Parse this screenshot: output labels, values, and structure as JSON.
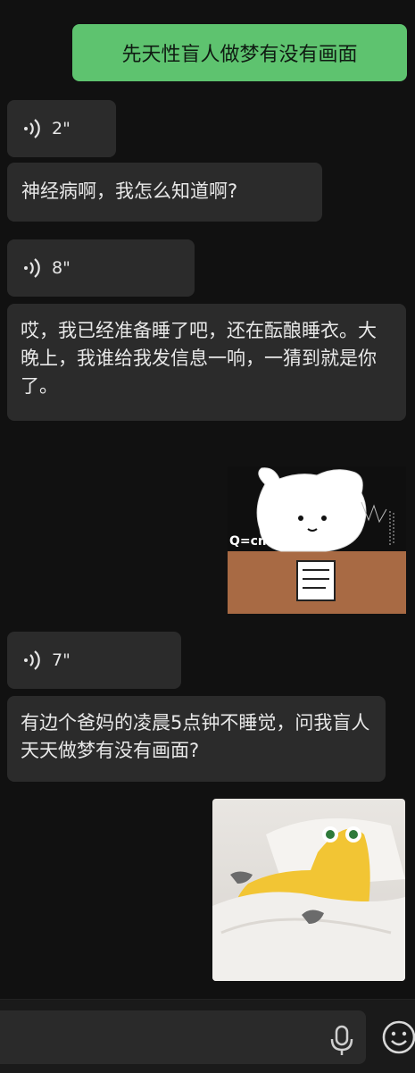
{
  "messages": {
    "sent_1": "先天性盲人做梦有没有画面",
    "voice_1": "2\"",
    "text_1": "神经病啊，我怎么知道啊?",
    "voice_2": "8\"",
    "text_2": "哎，我已经准备睡了吧，还在酝酿睡衣。大晚上，我谁给我发信息一响，一猜到就是你了。",
    "voice_3": "7\"",
    "text_3": "有边个爸妈的凌晨5点钟不睡觉，问我盲人天天做梦有没有画面?"
  },
  "sticker": {
    "caption": "Q=cmat"
  },
  "colors": {
    "background": "#111111",
    "sent_bubble": "#5ec36f",
    "received_bubble": "#2b2b2b"
  },
  "icons": {
    "voice": "voice-wave-icon",
    "mic": "microphone-icon",
    "emoji": "emoji-icon"
  }
}
